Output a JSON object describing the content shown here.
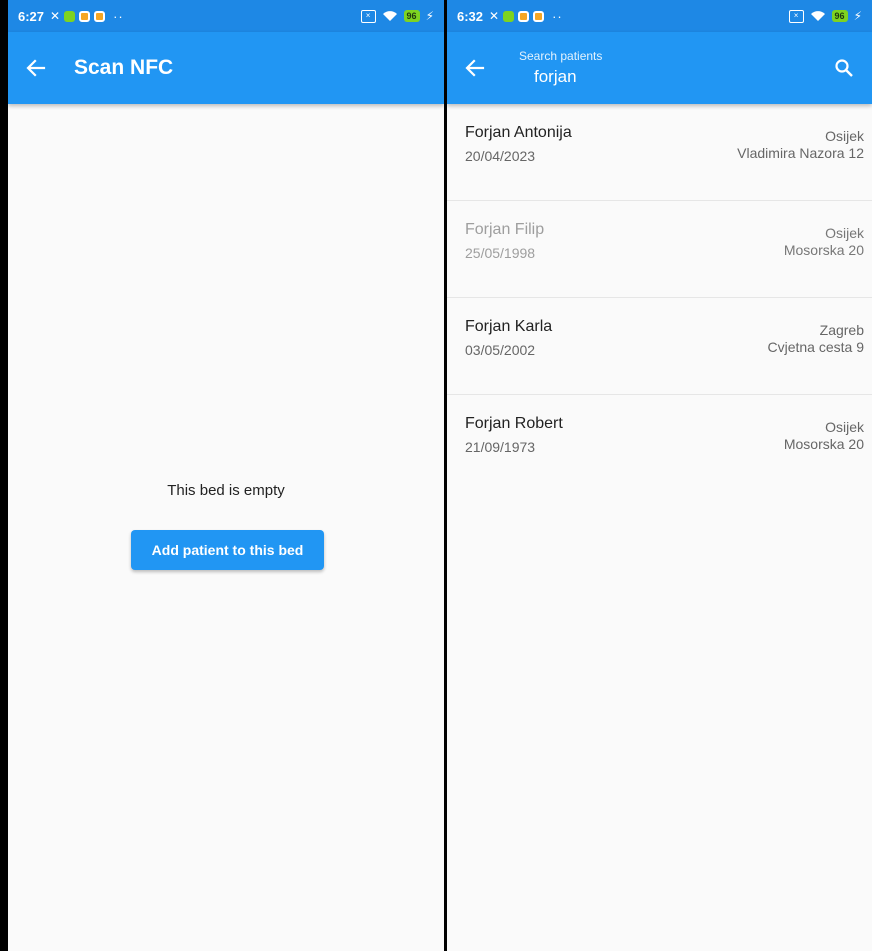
{
  "left_screen": {
    "status_bar": {
      "time": "6:27",
      "battery": "96"
    },
    "app_bar": {
      "title": "Scan NFC",
      "back_icon": "arrow-left-icon"
    },
    "empty_message": "This bed is empty",
    "add_button_label": "Add patient to this bed"
  },
  "right_screen": {
    "status_bar": {
      "time": "6:32",
      "battery": "96"
    },
    "app_bar": {
      "search_label": "Search patients",
      "search_value": "forjan",
      "back_icon": "arrow-left-icon",
      "search_icon": "search-icon"
    },
    "patients": [
      {
        "name": "Forjan Antonija",
        "dob": "20/04/2023",
        "city": "Osijek",
        "street": "Vladimira Nazora 12"
      },
      {
        "name": "Forjan Filip",
        "dob": "25/05/1998",
        "city": "Osijek",
        "street": "Mosorska 20"
      },
      {
        "name": "Forjan Karla",
        "dob": "03/05/2002",
        "city": "Zagreb",
        "street": "Cvjetna cesta 9"
      },
      {
        "name": "Forjan Robert",
        "dob": "21/09/1973",
        "city": "Osijek",
        "street": "Mosorska 20"
      }
    ]
  },
  "colors": {
    "status_bar": "#1e88e5",
    "app_bar": "#2196f3",
    "background": "#fafafa"
  }
}
